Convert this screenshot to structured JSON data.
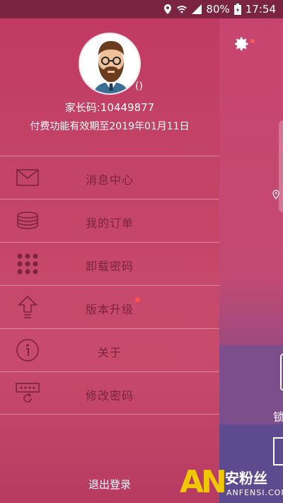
{
  "status_bar": {
    "battery": "80%",
    "time": "17:54",
    "icons": [
      "location-icon",
      "wifi-icon",
      "signal-icon",
      "battery-icon"
    ]
  },
  "drawer": {
    "user_suffix": "()",
    "parent_code": "家长码:10449877",
    "expiry": "付费功能有效期至2019年01月11日",
    "menu": [
      {
        "label": "消息中心",
        "icon": "envelope-icon"
      },
      {
        "label": "我的订单",
        "icon": "coins-icon"
      },
      {
        "label": "卸载密码",
        "icon": "keypad-icon"
      },
      {
        "label": "版本升级",
        "icon": "upgrade-arrow-icon",
        "badge": true
      },
      {
        "label": "关于",
        "icon": "info-icon"
      },
      {
        "label": "修改密码",
        "icon": "password-reset-icon"
      }
    ],
    "logout": "退出登录"
  },
  "background": {
    "partial_label": "锁"
  },
  "watermark": {
    "brand": "AN",
    "cn": "安粉丝",
    "en": "ANFENSI.COM"
  },
  "colors": {
    "drawer": "#c44468",
    "label": "#7a2440",
    "badge": "#ff5050",
    "status_bar": "#7a2442"
  }
}
